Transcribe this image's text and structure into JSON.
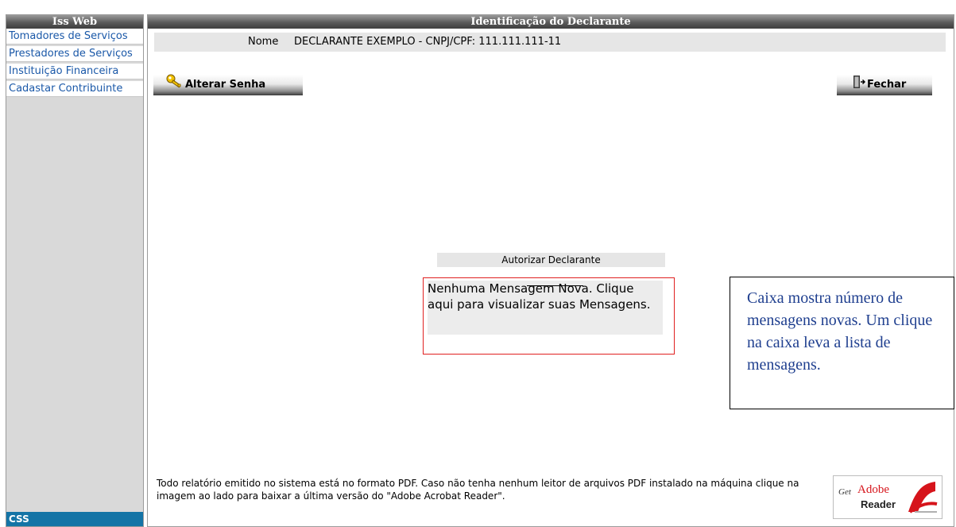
{
  "sidebar": {
    "title": "Iss Web",
    "items": [
      {
        "label": "Tomadores de Serviços"
      },
      {
        "label": "Prestadores de Serviços"
      },
      {
        "label": "Instituição Financeira"
      },
      {
        "label": "Cadastar Contribuinte"
      }
    ],
    "footer": "CSS"
  },
  "main": {
    "title": "Identificação do Declarante",
    "nome_label": "Nome",
    "nome_value": "DECLARANTE EXEMPLO - CNPJ/CPF: 111.111.111-11",
    "alterar_senha_label": "Alterar Senha",
    "fechar_label": "Fechar",
    "autorizar_label": "Autorizar Declarante",
    "message_box_text": "Nenhuma Mensagem Nova. Clique aqui para visualizar suas Mensagens.",
    "footer_text": "Todo relatório emitido no sistema está no formato PDF. Caso não tenha nenhum leitor de arquivos PDF instalado na máquina clique na imagem ao lado para baixar a última versão do \"Adobe Acrobat Reader\".",
    "adobe_badge": {
      "get": "Get",
      "brand": "Adobe",
      "product": "Reader"
    }
  },
  "callout": {
    "text": "Caixa mostra número de mensagens novas. Um clique na caixa leva a lista de mensagens."
  },
  "colors": {
    "header_gradient_dark": "#3e3e3e",
    "sidebar_link": "#1a58a8",
    "sidebar_footer": "#1474a6",
    "message_border": "#e02020",
    "callout_text": "#1f3f8f",
    "adobe_red": "#d6141b"
  },
  "icons": {
    "alterar_senha": "key-icon",
    "fechar": "door-exit-icon",
    "adobe": "adobe-reader-logo-icon"
  }
}
